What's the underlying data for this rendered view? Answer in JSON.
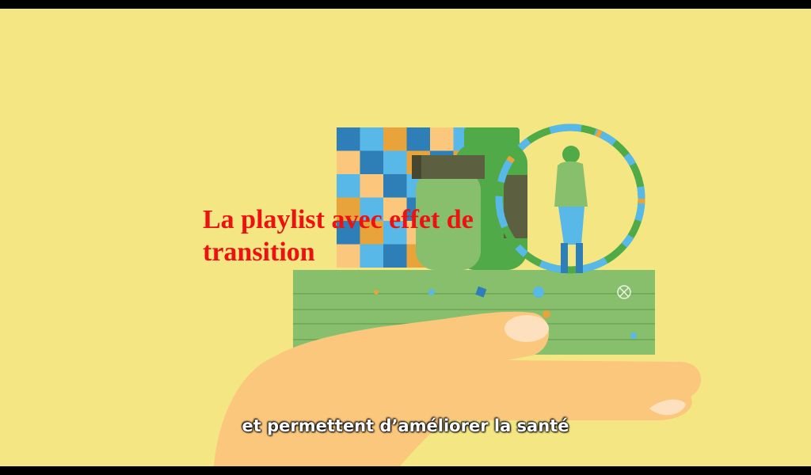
{
  "overlay": {
    "title": "La playlist avec effet de transition",
    "title_color": "#ee1111"
  },
  "video": {
    "subtitle": "et permettent d’améliorer la santé",
    "background_color": "#f4e783"
  },
  "icons": {
    "illustration": "hand-holding-health-items-illustration"
  }
}
